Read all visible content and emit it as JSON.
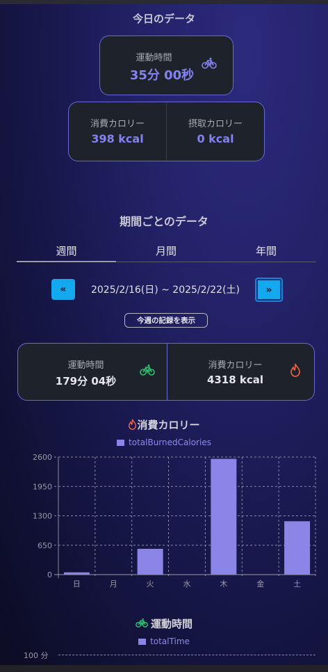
{
  "today": {
    "title": "今日のデータ",
    "exercise_label": "運動時間",
    "exercise_value": "35分 00秒",
    "burned_label": "消費カロリー",
    "burned_value": "398 kcal",
    "intake_label": "摂取カロリー",
    "intake_value": "0 kcal"
  },
  "period": {
    "title": "期間ごとのデータ",
    "tabs": [
      "週間",
      "月間",
      "年間"
    ],
    "active_tab": 0,
    "prev_label": "«",
    "next_label": "»",
    "range": "2025/2/16(日) ~ 2025/2/22(土)",
    "this_week_button": "今週の記録を表示",
    "exercise_label": "運動時間",
    "exercise_value": "179分 04秒",
    "burned_label": "消費カロリー",
    "burned_value": "4318 kcal"
  },
  "colors": {
    "accent": "#8481f0",
    "nav_button": "#14a8ee",
    "bar": "#8a85e6",
    "card_border": "#6a68d8",
    "bike_icon": "#2fbf71",
    "flame_icon": "#f0644c"
  },
  "charts": {
    "calories_title": "消費カロリー",
    "time_title": "運動時間",
    "time_legend": "totalTime",
    "time_ytick_top": "100 分"
  },
  "chart_data": [
    {
      "type": "bar",
      "title": "消費カロリー",
      "legend": "totalBurnedCalories",
      "categories": [
        "日",
        "月",
        "火",
        "水",
        "木",
        "金",
        "土"
      ],
      "values": [
        50,
        0,
        570,
        0,
        2560,
        0,
        1180
      ],
      "yticks": [
        0,
        650,
        1300,
        1950,
        2600
      ],
      "ylim": [
        0,
        2600
      ],
      "grid": true
    }
  ]
}
